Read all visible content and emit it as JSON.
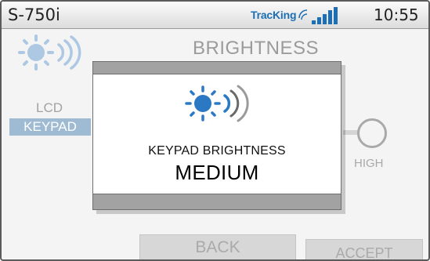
{
  "status_bar": {
    "model": "S-750i",
    "brand_part1": "Trac",
    "brand_part2": "King",
    "time": "10:55"
  },
  "background_screen": {
    "title": "BRIGHTNESS",
    "menu": {
      "lcd_label": "LCD",
      "keypad_label": "KEYPAD",
      "selected": "KEYPAD"
    },
    "slider": {
      "high_label": "HIGH",
      "level": "MEDIUM"
    },
    "buttons": {
      "back_label": "BACK",
      "accept_label": "ACCEPT"
    },
    "icon": "brightness-sun-icon"
  },
  "modal": {
    "heading": "KEYPAD BRIGHTNESS",
    "value": "MEDIUM",
    "icon": "brightness-sun-icon"
  },
  "colors": {
    "accent_blue": "#1d6fb5",
    "icon_blue": "#2b78c4",
    "selected_menu_bg": "#9fbad3",
    "modal_bar_gray": "#a2a2a2"
  }
}
